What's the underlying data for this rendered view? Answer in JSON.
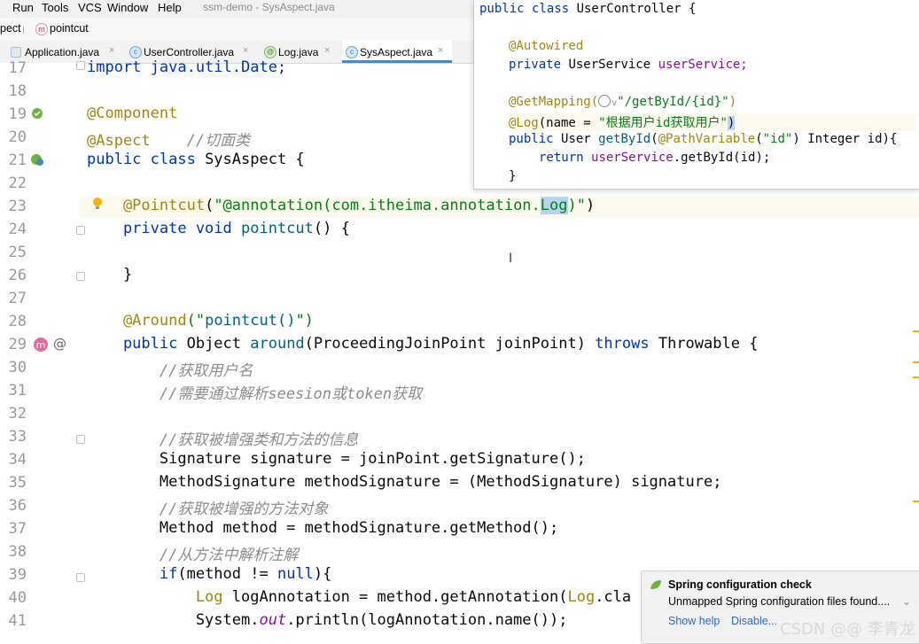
{
  "menu": {
    "items": [
      "Run",
      "Tools",
      "VCS",
      "Window",
      "Help"
    ],
    "window_title": "ssm-demo - SysAspect.java"
  },
  "breadcrumb": {
    "class_label": "pect",
    "method_label": "pointcut",
    "method_badge": "m"
  },
  "tabs": [
    {
      "label": "Application.java",
      "icon": "java-file-icon",
      "close": "×"
    },
    {
      "label": "UserController.java",
      "icon": "class-icon",
      "icon_letter": "c",
      "close": "×"
    },
    {
      "label": "Log.java",
      "icon": "annotation-icon",
      "icon_letter": "@",
      "close": "×"
    },
    {
      "label": "SysAspect.java",
      "icon": "class-icon",
      "icon_letter": "c",
      "close": "×",
      "active": true
    }
  ],
  "editor": {
    "line_numbers": [
      "17",
      "18",
      "19",
      "20",
      "21",
      "22",
      "23",
      "24",
      "25",
      "26",
      "27",
      "28",
      "29",
      "30",
      "31",
      "32",
      "33",
      "34",
      "35",
      "36",
      "37",
      "38",
      "39",
      "40",
      "41"
    ],
    "lines": {
      "l17": "import java.util.Date;",
      "l19": "@Component",
      "l20a": "@Aspect",
      "l20b": "    //切面类",
      "l21a": "public class ",
      "l21b": "SysAspect {",
      "l23a": "    @Pointcut",
      "l23b": "(",
      "l23c": "\"@annotation(com.itheima.annotation.",
      "l23d": "Log",
      "l23e": ")\"",
      "l23f": ")",
      "l24a": "    private void ",
      "l24b": "pointcut",
      "l24c": "() {",
      "l26": "    }",
      "l28a": "    @Around",
      "l28b": "(\"",
      "l28c": "pointcut()",
      "l28d": "\")",
      "l29a": "    public ",
      "l29b": "Object ",
      "l29c": "around",
      "l29d": "(ProceedingJoinPoint joinPoint) ",
      "l29e": "throws ",
      "l29f": "Throwable {",
      "l30": "        //获取用户名",
      "l31": "        //需要通过解析seesion或token获取",
      "l33": "        //获取被增强类和方法的信息",
      "l34": "        Signature signature = joinPoint.getSignature();",
      "l35": "        MethodSignature methodSignature = (MethodSignature) signature;",
      "l36": "        //获取被增强的方法对象",
      "l37": "        Method method = methodSignature.getMethod();",
      "l38": "        //从方法中解析注解",
      "l39a": "        if",
      "l39b": "(method != ",
      "l39c": "null",
      "l39d": "){",
      "l40a": "            Log ",
      "l40b": "logAnnotation = method.getAnnotation(",
      "l40c": "Log",
      "l40d": ".cla",
      "l41a": "            System.",
      "l41b": "out",
      "l41c": ".println(logAnnotation.name());"
    }
  },
  "popup": {
    "p1a": "public class ",
    "p1b": "UserController {",
    "p3": "@Autowired",
    "p4a": "private ",
    "p4b": "UserService ",
    "p4c": "userService;",
    "p6a": "@GetMapping(",
    "p6b": "\"/getById/{id}\"",
    "p6c": ")",
    "p7a": "@Log",
    "p7b": "(name = ",
    "p7c": "\"根据用户id获取用户\"",
    "p7d": ")",
    "p8a": "public ",
    "p8b": "User ",
    "p8c": "getById",
    "p8d": "(",
    "p8e": "@PathVariable",
    "p8f": "(",
    "p8g": "\"id\"",
    "p8h": ") Integer id){",
    "p9a": "return ",
    "p9b": "userService",
    "p9c": ".getById(id);",
    "p10": "}"
  },
  "notification": {
    "title": "Spring configuration check",
    "body": "Unmapped Spring configuration files found....",
    "link_help": "Show help",
    "link_disable": "Disable..."
  },
  "watermark": "CSDN @@ 李青龙",
  "colors": {
    "keyword": "#0033b3",
    "annotation": "#9e880d",
    "string": "#067d17",
    "comment": "#8c8c8c",
    "accent": "#4a88c7"
  }
}
